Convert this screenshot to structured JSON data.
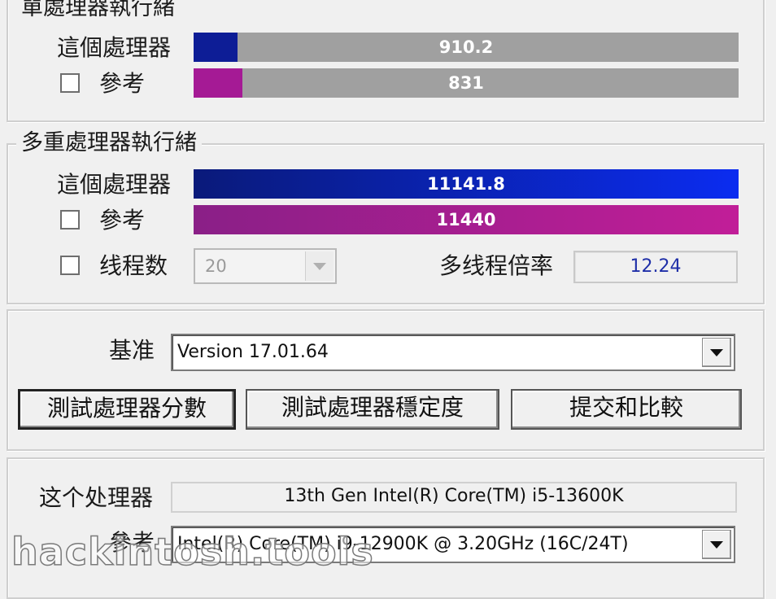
{
  "single_thread": {
    "title": "單處理器執行緒",
    "this_cpu": {
      "label": "這個處理器",
      "value": "910.2",
      "fraction": 0.08,
      "color": "#0d1d96"
    },
    "reference": {
      "label": "參考",
      "value": "831",
      "fraction": 0.09,
      "color": "#a51a95"
    }
  },
  "multi_thread": {
    "title": "多重處理器執行緒",
    "this_cpu": {
      "label": "這個處理器",
      "value": "11141.8",
      "fraction": 1.0,
      "color_start": "#0a1a7a",
      "color_end": "#0b2cf0"
    },
    "reference": {
      "label": "參考",
      "value": "11440",
      "fraction": 1.0,
      "color_start": "#8a1f87",
      "color_end": "#c11e98"
    },
    "threads": {
      "label": "线程数",
      "value": "20"
    },
    "multithread_ratio": {
      "label": "多线程倍率",
      "value": "12.24"
    }
  },
  "benchmark": {
    "label": "基准",
    "version": "Version 17.01.64",
    "buttons": {
      "bench_cpu": "測試處理器分數",
      "stress_cpu": "測試處理器穩定度",
      "submit": "提交和比較"
    }
  },
  "cpu_info": {
    "this_cpu_label": "这个处理器",
    "this_cpu_name": "13th Gen Intel(R) Core(TM) i5-13600K",
    "reference_label": "參考",
    "reference_name": "Intel(R) Core(TM) i9-12900K @ 3.20GHz (16C/24T)"
  },
  "watermark": "hackintosh.tools"
}
